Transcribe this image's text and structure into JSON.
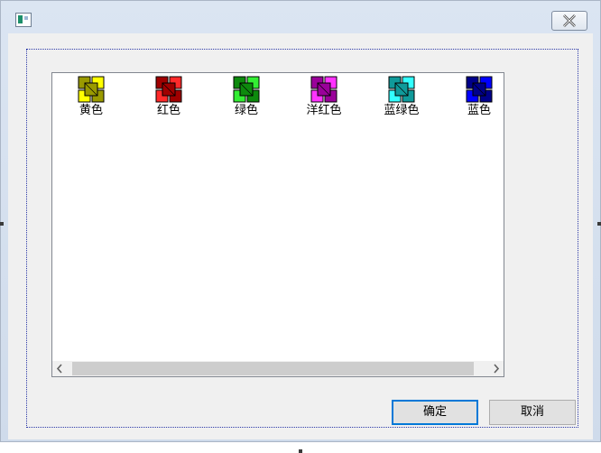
{
  "window": {
    "title": "",
    "icon": "app-window-icon",
    "close_icon": "close-icon"
  },
  "colors": {
    "focus": "#2d3aa8",
    "button_focus": "#0078d7"
  },
  "list": {
    "items": [
      {
        "label": "黄色",
        "icon": "yellow-tile-icon",
        "dark": "#9a9a00",
        "light": "#ffff00"
      },
      {
        "label": "红色",
        "icon": "red-tile-icon",
        "dark": "#a00000",
        "light": "#ff2a2a"
      },
      {
        "label": "绿色",
        "icon": "green-tile-icon",
        "dark": "#0d8a0d",
        "light": "#33ee33"
      },
      {
        "label": "洋红色",
        "icon": "magenta-tile-icon",
        "dark": "#9a009a",
        "light": "#ff33ff"
      },
      {
        "label": "蓝绿色",
        "icon": "cyan-tile-icon",
        "dark": "#109a9a",
        "light": "#33ffff"
      },
      {
        "label": "蓝色",
        "icon": "blue-tile-icon",
        "dark": "#00008a",
        "light": "#0000ff"
      }
    ]
  },
  "buttons": {
    "ok": "确定",
    "cancel": "取消"
  }
}
